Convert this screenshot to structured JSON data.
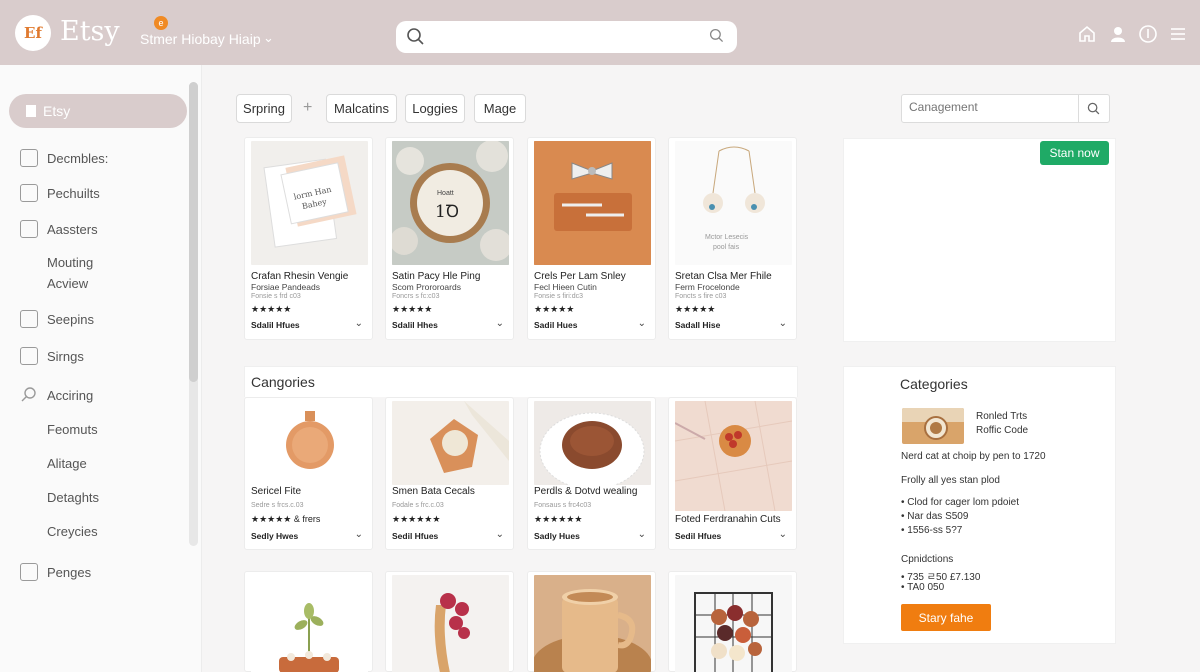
{
  "header": {
    "logo_badge": "Ef",
    "logo_text": "Etsy",
    "shop_badge": "e",
    "shop_label": "Stmer Hiobay Hiaip",
    "search_placeholder": ""
  },
  "sidebar": {
    "active_label": "Etsy",
    "items": [
      {
        "label": "Decmbles:"
      },
      {
        "label": "Pechuilts"
      },
      {
        "label": "Aassters"
      },
      {
        "label": "Mouting"
      },
      {
        "label": "Acview"
      },
      {
        "label": "Seepins"
      },
      {
        "label": "Sirngs"
      },
      {
        "label": "Acciring"
      },
      {
        "label": "Feomuts"
      },
      {
        "label": "Alitage"
      },
      {
        "label": "Detaghts"
      },
      {
        "label": "Creycies"
      },
      {
        "label": "Penges"
      }
    ]
  },
  "filters": {
    "chips": [
      "Srpring",
      "Malcatins",
      "Loggies",
      "Mage"
    ],
    "plus": "+",
    "category_search_placeholder": "Canagement"
  },
  "products_row1": [
    {
      "title": "Crafan Rhesin Vengie",
      "subtitle": "Forsiae Pandeads",
      "meta": "Fonsie s frd c03",
      "stars": "★★★★★",
      "selector": "Sdalil Hfues"
    },
    {
      "title": "Satin Pacy Hle Ping",
      "subtitle": "Scom Prororoards",
      "meta": "Foncrs s fc:c03",
      "stars": "★★★★★",
      "selector": "Sdalil Hhes"
    },
    {
      "title": "Crels Per Lam Snley",
      "subtitle": "Fecl Hieen Cutin",
      "meta": "Fonsie s firi:dc3",
      "stars": "★★★★★",
      "selector": "Sadil Hues"
    },
    {
      "title": "Sretan Clsa Mer Fhile",
      "subtitle": "Ferm Frocelonde",
      "meta": "Foncts s fire c03",
      "stars": "★★★★★",
      "selector": "Sadall Hise"
    }
  ],
  "section": {
    "title": "Cangories"
  },
  "products_row2": [
    {
      "title": "Sericel Fite",
      "subtitle": "Sedre s frcs.c.03",
      "stars": "★★★★★ & frers",
      "selector": "Sedly Hwes"
    },
    {
      "title": "Smen Bata Cecals",
      "subtitle": "Fodale s frc.c.03",
      "stars": "★★★★★★",
      "selector": "Sedil Hfues"
    },
    {
      "title": "Perdls & Dotvd wealing",
      "subtitle": "Fonsaus s frc4c03",
      "stars": "★★★★★★",
      "selector": "Sadly Hues"
    },
    {
      "title": "Foted Ferdranahin Cuts",
      "selector": "Sedil Hfues"
    }
  ],
  "actions": {
    "new_button": "Stan now",
    "apply_button": "Stary fahe"
  },
  "categories_panel": {
    "title": "Categories",
    "thumb_line1": "Ronled Trts",
    "thumb_line2": "Roffic Code",
    "line1": "Nerd cat at choip by pen to 1720",
    "line2": "Frolly all yes stan plod",
    "bullets": [
      "• Clod for cager lom pdoiet",
      "• Nar das S509",
      "• 1556-ss 5?7"
    ],
    "sub_title": "Cpnidctions",
    "codes": [
      "• 735 ㄹ50 £7.130",
      "• TA0 050"
    ]
  },
  "colors": {
    "header_bg": "#d9cccc",
    "accent_green": "#1faa66",
    "accent_orange": "#f07d10",
    "logo_orange": "#e07a2f"
  },
  "icons": [
    "search-icon",
    "home-icon",
    "user-icon",
    "account-badge-icon",
    "menu-icon",
    "chevron-down-icon"
  ]
}
